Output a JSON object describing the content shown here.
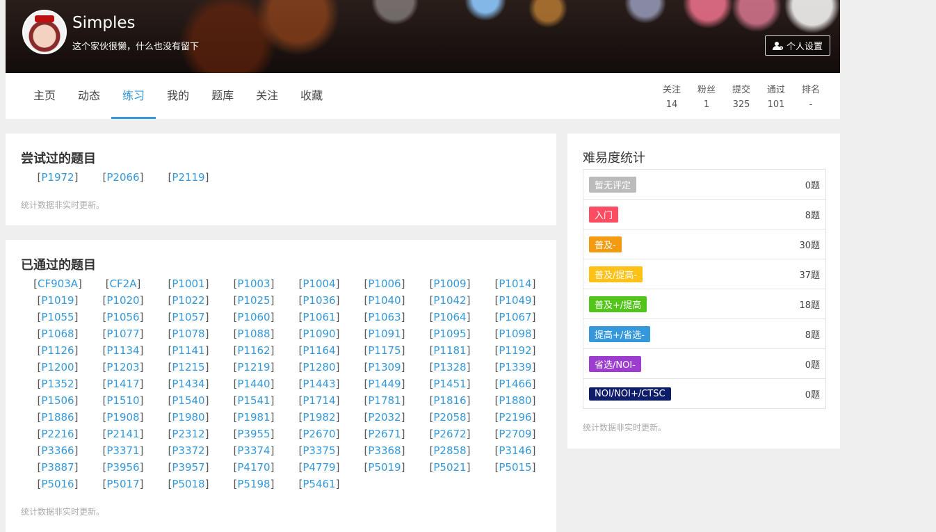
{
  "header": {
    "username": "Simples",
    "motto": "这个家伙很懒，什么也没有留下",
    "settings_label": "个人设置"
  },
  "nav": {
    "tabs": [
      {
        "label": "主页"
      },
      {
        "label": "动态"
      },
      {
        "label": "练习",
        "active": true
      },
      {
        "label": "我的"
      },
      {
        "label": "题库"
      },
      {
        "label": "关注"
      },
      {
        "label": "收藏"
      }
    ],
    "stats": [
      {
        "label": "关注",
        "value": "14"
      },
      {
        "label": "粉丝",
        "value": "1"
      },
      {
        "label": "提交",
        "value": "325"
      },
      {
        "label": "通过",
        "value": "101"
      },
      {
        "label": "排名",
        "value": "-"
      }
    ]
  },
  "attempted": {
    "title": "尝试过的题目",
    "problems": [
      "P1972",
      "P2066",
      "P2119"
    ],
    "note": "统计数据非实时更新。"
  },
  "passed": {
    "title": "已通过的题目",
    "problems": [
      "CF903A",
      "CF2A",
      "P1001",
      "P1003",
      "P1004",
      "P1006",
      "P1009",
      "P1014",
      "P1019",
      "P1020",
      "P1022",
      "P1025",
      "P1036",
      "P1040",
      "P1042",
      "P1049",
      "P1055",
      "P1056",
      "P1057",
      "P1060",
      "P1061",
      "P1063",
      "P1064",
      "P1067",
      "P1068",
      "P1077",
      "P1078",
      "P1088",
      "P1090",
      "P1091",
      "P1095",
      "P1098",
      "P1126",
      "P1134",
      "P1141",
      "P1162",
      "P1164",
      "P1175",
      "P1181",
      "P1192",
      "P1200",
      "P1203",
      "P1215",
      "P1219",
      "P1280",
      "P1309",
      "P1328",
      "P1339",
      "P1352",
      "P1417",
      "P1434",
      "P1440",
      "P1443",
      "P1449",
      "P1451",
      "P1466",
      "P1506",
      "P1510",
      "P1540",
      "P1541",
      "P1714",
      "P1781",
      "P1816",
      "P1880",
      "P1886",
      "P1908",
      "P1980",
      "P1981",
      "P1982",
      "P2032",
      "P2058",
      "P2196",
      "P2216",
      "P2141",
      "P2312",
      "P3955",
      "P2670",
      "P2671",
      "P2672",
      "P2709",
      "P3366",
      "P3371",
      "P3372",
      "P3374",
      "P3375",
      "P3368",
      "P2858",
      "P3146",
      "P3887",
      "P3956",
      "P3957",
      "P4170",
      "P4779",
      "P5019",
      "P5021",
      "P5015",
      "P5016",
      "P5017",
      "P5018",
      "P5198",
      "P5461"
    ],
    "note": "统计数据非实时更新。"
  },
  "difficulty": {
    "title": "难易度统计",
    "rows": [
      {
        "label": "暂无评定",
        "count": "0题",
        "color": "#bbbbbb"
      },
      {
        "label": "入门",
        "count": "8题",
        "color": "#fe4c61"
      },
      {
        "label": "普及-",
        "count": "30题",
        "color": "#f39c11"
      },
      {
        "label": "普及/提高-",
        "count": "37题",
        "color": "#ffc116"
      },
      {
        "label": "普及+/提高",
        "count": "18题",
        "color": "#52c41a"
      },
      {
        "label": "提高+/省选-",
        "count": "8题",
        "color": "#3498db"
      },
      {
        "label": "省选/NOI-",
        "count": "0题",
        "color": "#9d3dcf"
      },
      {
        "label": "NOI/NOI+/CTSC",
        "count": "0题",
        "color": "#0e1d69"
      }
    ],
    "note": "统计数据非实时更新。"
  }
}
